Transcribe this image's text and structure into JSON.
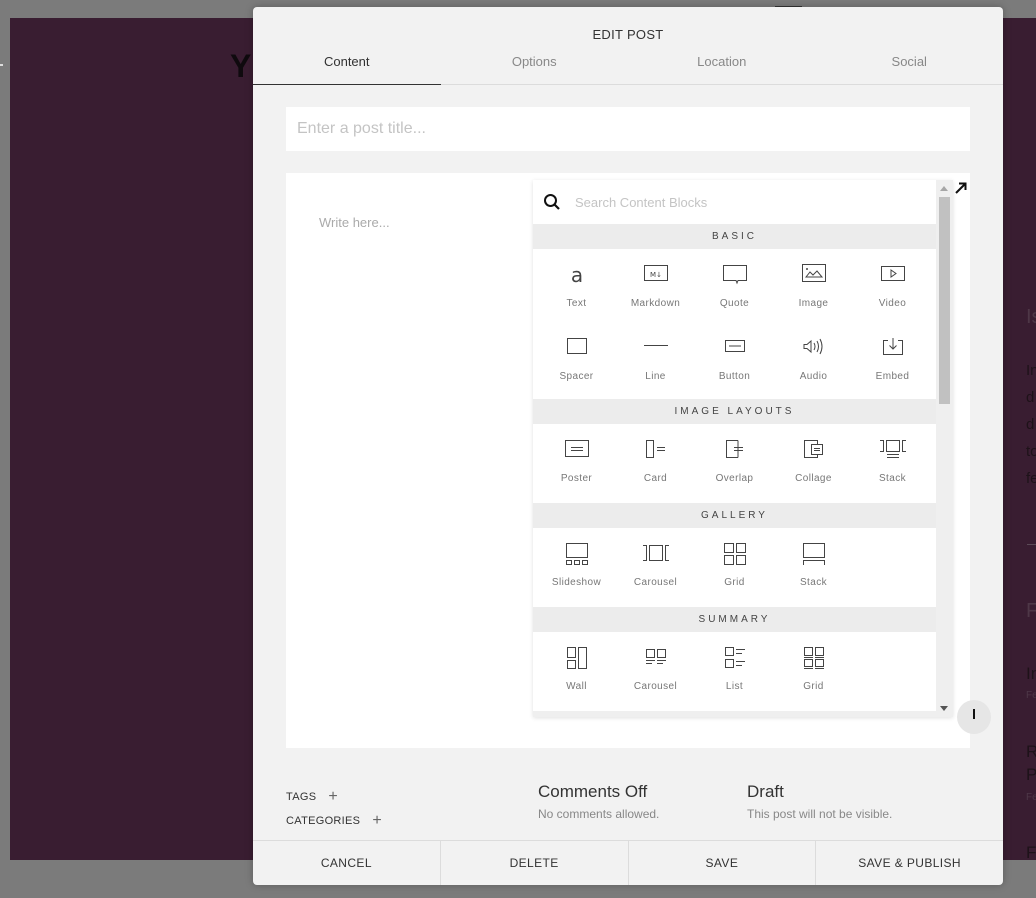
{
  "background": {
    "heading_fragment": "Y",
    "side_texts": [
      "Is",
      "In",
      "d",
      "d",
      "to",
      "fe",
      "F",
      "In",
      "Fe",
      "R",
      "P",
      "Fe",
      "F"
    ]
  },
  "modal": {
    "title": "EDIT POST",
    "tabs": [
      {
        "label": "Content",
        "active": true
      },
      {
        "label": "Options",
        "active": false
      },
      {
        "label": "Location",
        "active": false
      },
      {
        "label": "Social",
        "active": false
      }
    ],
    "title_input": {
      "value": "",
      "placeholder": "Enter a post title..."
    },
    "editor": {
      "placeholder": "Write here..."
    },
    "block_picker": {
      "search_placeholder": "Search Content Blocks",
      "sections": [
        {
          "title": "BASIC",
          "blocks": [
            {
              "label": "Text",
              "icon": "text-icon"
            },
            {
              "label": "Markdown",
              "icon": "markdown-icon"
            },
            {
              "label": "Quote",
              "icon": "quote-icon"
            },
            {
              "label": "Image",
              "icon": "image-icon"
            },
            {
              "label": "Video",
              "icon": "video-icon"
            },
            {
              "label": "Spacer",
              "icon": "spacer-icon"
            },
            {
              "label": "Line",
              "icon": "line-icon"
            },
            {
              "label": "Button",
              "icon": "button-icon"
            },
            {
              "label": "Audio",
              "icon": "audio-icon"
            },
            {
              "label": "Embed",
              "icon": "embed-icon"
            }
          ]
        },
        {
          "title": "IMAGE LAYOUTS",
          "blocks": [
            {
              "label": "Poster",
              "icon": "poster-icon"
            },
            {
              "label": "Card",
              "icon": "card-icon"
            },
            {
              "label": "Overlap",
              "icon": "overlap-icon"
            },
            {
              "label": "Collage",
              "icon": "collage-icon"
            },
            {
              "label": "Stack",
              "icon": "stack-layout-icon"
            }
          ]
        },
        {
          "title": "GALLERY",
          "blocks": [
            {
              "label": "Slideshow",
              "icon": "slideshow-icon"
            },
            {
              "label": "Carousel",
              "icon": "gallery-carousel-icon"
            },
            {
              "label": "Grid",
              "icon": "gallery-grid-icon"
            },
            {
              "label": "Stack",
              "icon": "gallery-stack-icon"
            }
          ]
        },
        {
          "title": "SUMMARY",
          "blocks": [
            {
              "label": "Wall",
              "icon": "wall-icon"
            },
            {
              "label": "Carousel",
              "icon": "summary-carousel-icon"
            },
            {
              "label": "List",
              "icon": "list-icon"
            },
            {
              "label": "Grid",
              "icon": "summary-grid-icon"
            }
          ]
        }
      ]
    },
    "meta": {
      "tags_label": "TAGS",
      "categories_label": "CATEGORIES",
      "plus_glyph": "+",
      "comments": {
        "title": "Comments Off",
        "subtitle": "No comments allowed."
      },
      "status": {
        "title": "Draft",
        "subtitle": "This post will not be visible."
      }
    },
    "footer": {
      "cancel": "CANCEL",
      "delete": "DELETE",
      "save": "SAVE",
      "save_publish": "SAVE & PUBLISH"
    }
  }
}
